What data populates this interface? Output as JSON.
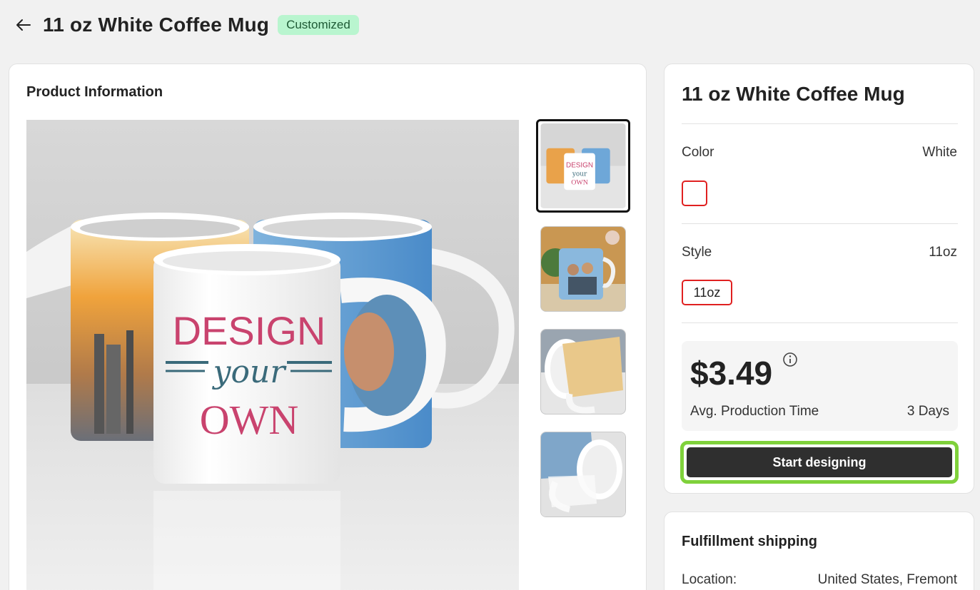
{
  "header": {
    "title": "11 oz White Coffee Mug",
    "badge": "Customized",
    "back_icon": "arrow-left-icon"
  },
  "product_info": {
    "section_title": "Product Information",
    "main_image_text": {
      "line1": "DESIGN",
      "line2": "your",
      "line3": "OWN"
    },
    "thumbnails": [
      {
        "name": "thumbnail-three-mugs",
        "active": true
      },
      {
        "name": "thumbnail-family-mug",
        "active": false
      },
      {
        "name": "thumbnail-mug-side",
        "active": false
      },
      {
        "name": "thumbnail-mug-tilted",
        "active": false
      }
    ]
  },
  "details": {
    "title": "11 oz White Coffee Mug",
    "color_label": "Color",
    "color_value": "White",
    "swatch_color": "#ffffff",
    "style_label": "Style",
    "style_value": "11oz",
    "style_option": "11oz",
    "price": "$3.49",
    "info_icon": "info-circle-icon",
    "production_label": "Avg. Production Time",
    "production_value": "3 Days",
    "start_button": "Start designing"
  },
  "shipping": {
    "title": "Fulfillment shipping",
    "location_label": "Location:",
    "location_value": "United States, Fremont"
  },
  "colors": {
    "accent_green": "#7fd13b",
    "badge_bg": "#b9f5cf",
    "selected_border": "#e02020",
    "button_dark": "#2f2f2f"
  }
}
